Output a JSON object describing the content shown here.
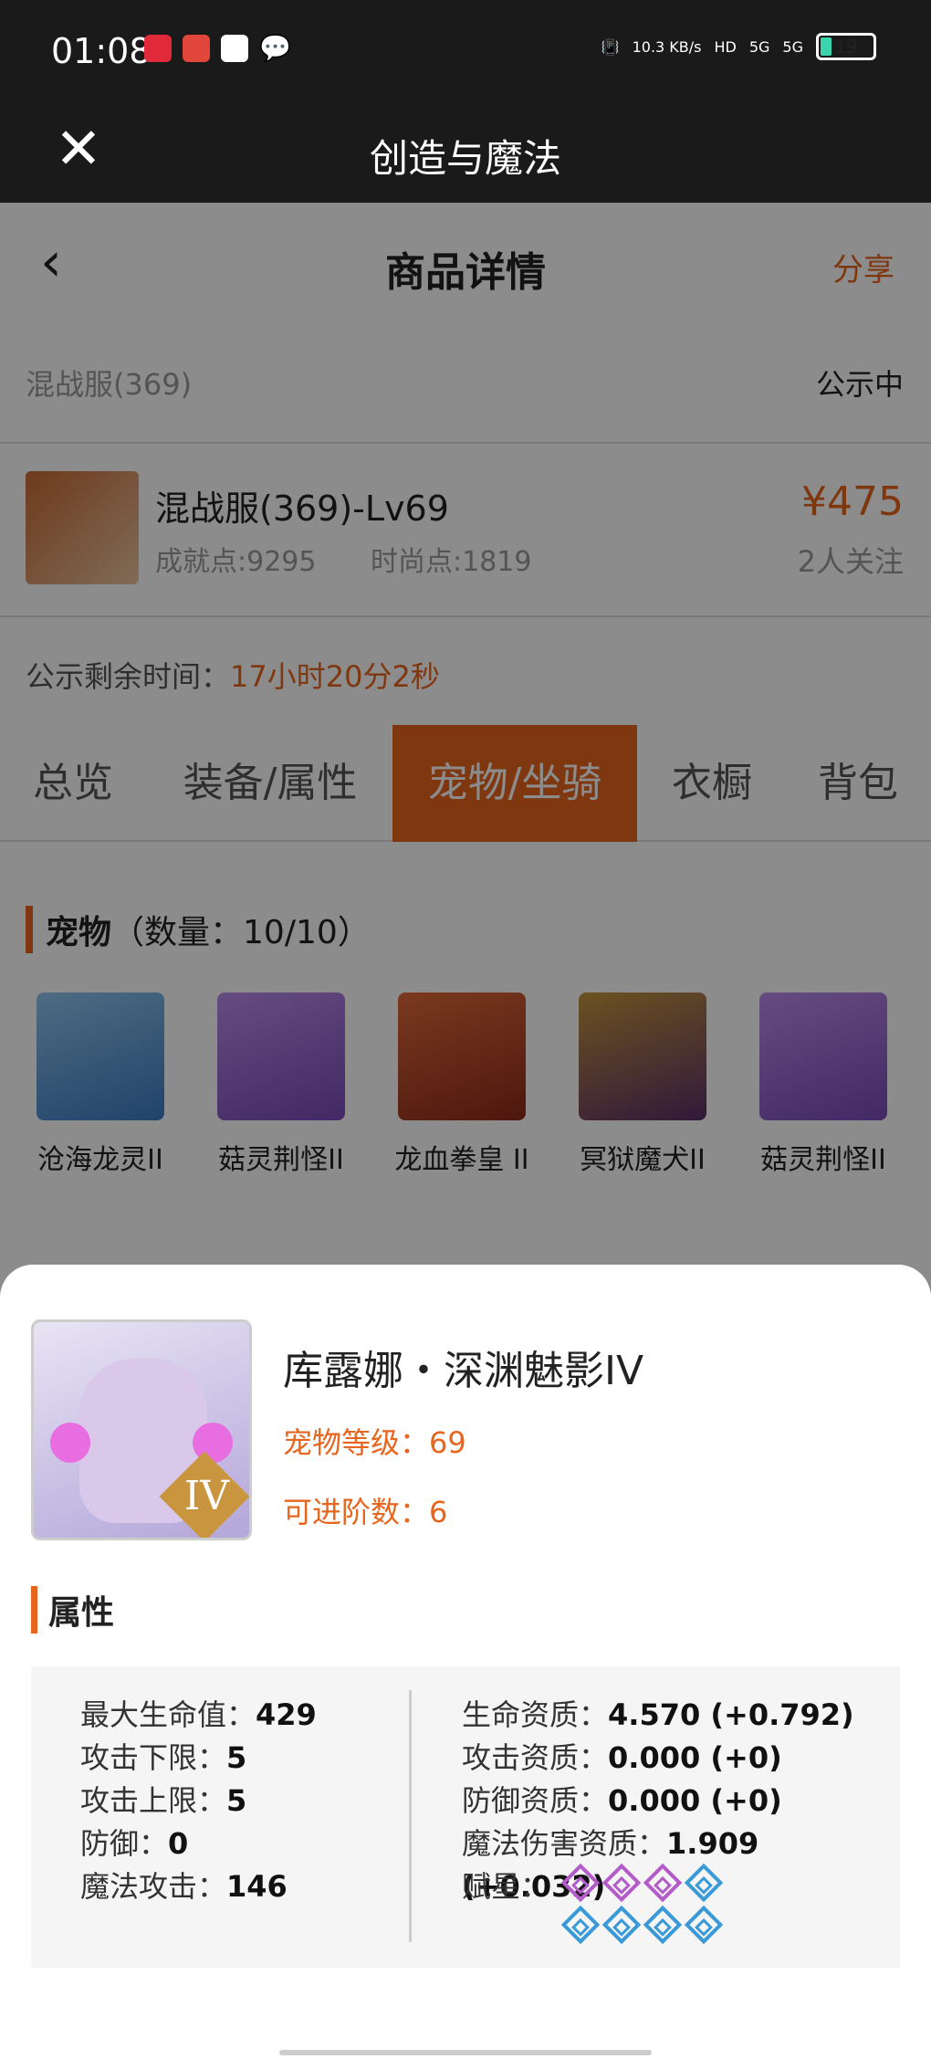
{
  "status": {
    "time": "01:08",
    "net_speed": "10.3 KB/s",
    "hd": "HD",
    "sig1": "5G",
    "sig2": "5G",
    "battery": "19"
  },
  "titlebar": {
    "title": "创造与魔法"
  },
  "nav": {
    "back": "‹",
    "title": "商品详情",
    "share": "分享"
  },
  "server": {
    "name": "混战服(369)",
    "status": "公示中"
  },
  "item": {
    "name": "混战服(369)-Lv69",
    "achievement": "成就点:9295",
    "fashion": "时尚点:1819",
    "price": "¥475",
    "followers": "2人关注"
  },
  "remain": {
    "label": "公示剩余时间：",
    "value": "17小时20分2秒"
  },
  "tabs": [
    "总览",
    "装备/属性",
    "宠物/坐骑",
    "衣橱",
    "背包"
  ],
  "pets": {
    "title": "宠物",
    "count": "（数量：10/10）",
    "items": [
      "沧海龙灵II",
      "菇灵荆怪II",
      "龙血拳皇 II",
      "冥狱魔犬II",
      "菇灵荆怪II"
    ]
  },
  "sheet": {
    "name": "库露娜・深渊魅影IV",
    "badge": "IV",
    "level": "宠物等级：69",
    "advance": "可进阶数：6",
    "section": "属性",
    "left": [
      {
        "label": "最大生命值：",
        "value": "429"
      },
      {
        "label": "攻击下限：",
        "value": "5"
      },
      {
        "label": "攻击上限：",
        "value": "5"
      },
      {
        "label": "防御：",
        "value": "0"
      },
      {
        "label": "魔法攻击：",
        "value": "146"
      }
    ],
    "right": [
      {
        "label": "生命资质：",
        "value": "4.570 (+0.792)"
      },
      {
        "label": "攻击资质：",
        "value": "0.000 (+0)"
      },
      {
        "label": "防御资质：",
        "value": "0.000 (+0)"
      },
      {
        "label": "魔法伤害资质：",
        "value": "1.909 (+0.032)"
      },
      {
        "label": "赋星：",
        "value": ""
      }
    ],
    "stars": [
      "purple",
      "purple",
      "purple",
      "blue",
      "blue",
      "blue",
      "blue",
      "blue"
    ]
  },
  "colors": {
    "accent": "#e8651d",
    "star_blue": "#3a9ad8",
    "star_purple": "#b35bc9"
  }
}
